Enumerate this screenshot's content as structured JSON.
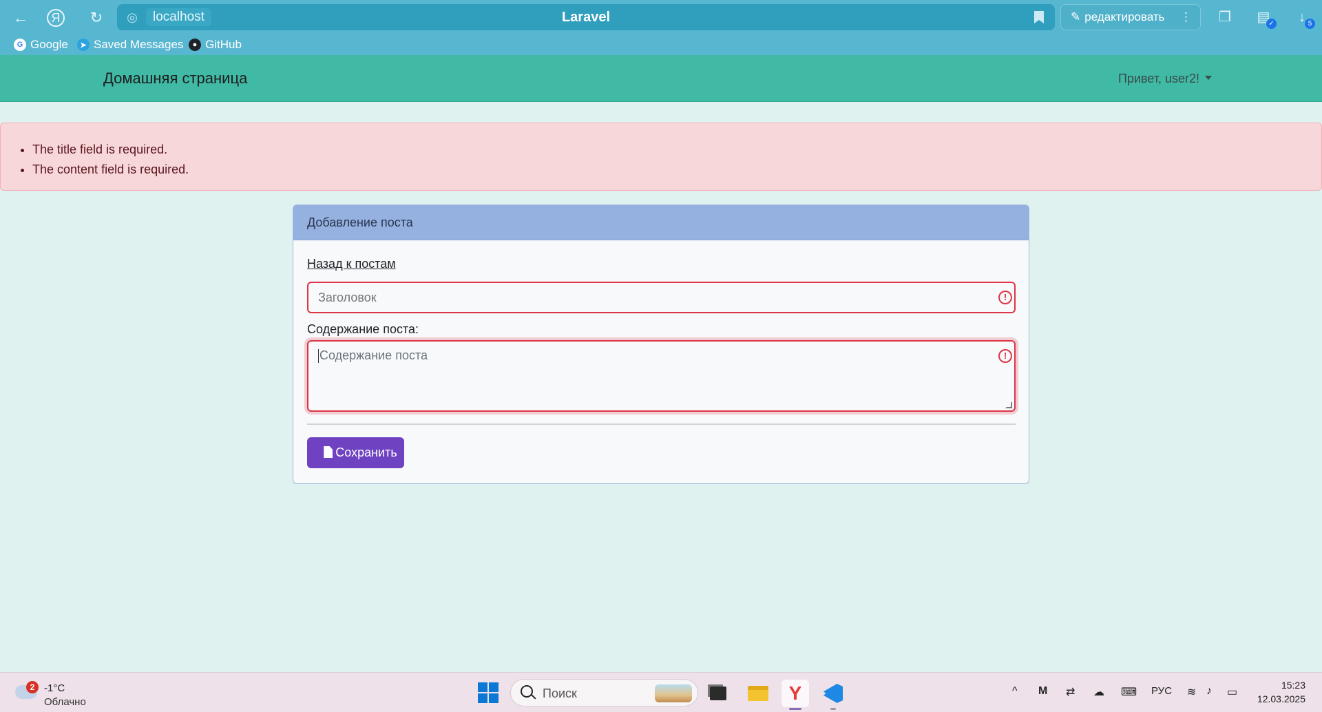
{
  "browser": {
    "url_host": "localhost",
    "tab_title": "Laravel",
    "edit_label": "редактировать",
    "downloads_count": "5",
    "bookmarks": [
      {
        "label": "Google"
      },
      {
        "label": "Saved Messages"
      },
      {
        "label": "GitHub"
      }
    ]
  },
  "navbar": {
    "brand": "Домашняя страница",
    "user_greeting": "Привет, user2!"
  },
  "alert": {
    "errors": [
      "The title field is required.",
      "The content field is required."
    ]
  },
  "form": {
    "card_title": "Добавление поста",
    "back_link": "Назад к постам",
    "title_placeholder": "Заголовок",
    "content_label": "Содержание поста:",
    "content_placeholder": "Содержание поста",
    "save_label": "Сохранить"
  },
  "taskbar": {
    "weather_badge": "2",
    "temperature": "-1°C",
    "condition": "Облачно",
    "search_placeholder": "Поиск",
    "language": "РУС",
    "time": "15:23",
    "date": "12.03.2025"
  },
  "colors": {
    "navbar": "#40b9a5",
    "card_header": "#95b1e0",
    "save_button": "#6f42c1",
    "error": "#dc3545",
    "alert_bg": "#f8d7da"
  }
}
